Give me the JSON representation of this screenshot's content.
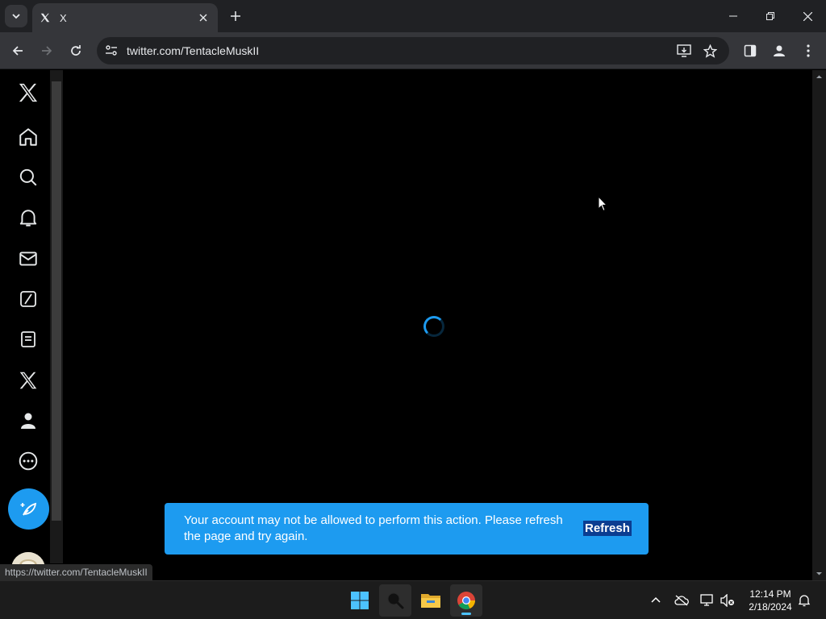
{
  "browser": {
    "tab_title": "X",
    "url": "twitter.com/TentacleMuskII",
    "status_url": "https://twitter.com/TentacleMuskII"
  },
  "toast": {
    "message": "Your account may not be allowed to perform this action. Please refresh the page and try again.",
    "action_label": "Refresh"
  },
  "taskbar": {
    "time": "12:14 PM",
    "date": "2/18/2024"
  },
  "colors": {
    "accent": "#1d9bf0",
    "browser_frame": "#202124",
    "browser_toolbar": "#35363a",
    "page_background": "#000000",
    "taskbar": "#1c1c1c"
  },
  "icons": {
    "side_nav": [
      "x-logo-icon",
      "home-icon",
      "search-icon",
      "notifications-bell-icon",
      "messages-envelope-icon",
      "grok-icon",
      "lists-icon",
      "premium-x-icon",
      "profile-person-icon",
      "more-circle-icon",
      "post-feather-icon"
    ],
    "taskbar": [
      "windows-start-icon",
      "search-icon",
      "file-explorer-icon",
      "chrome-icon"
    ],
    "tray": [
      "chevron-up-icon",
      "onedrive-cloud-icon",
      "network-icon",
      "volume-muted-icon",
      "notification-bell-icon"
    ]
  }
}
